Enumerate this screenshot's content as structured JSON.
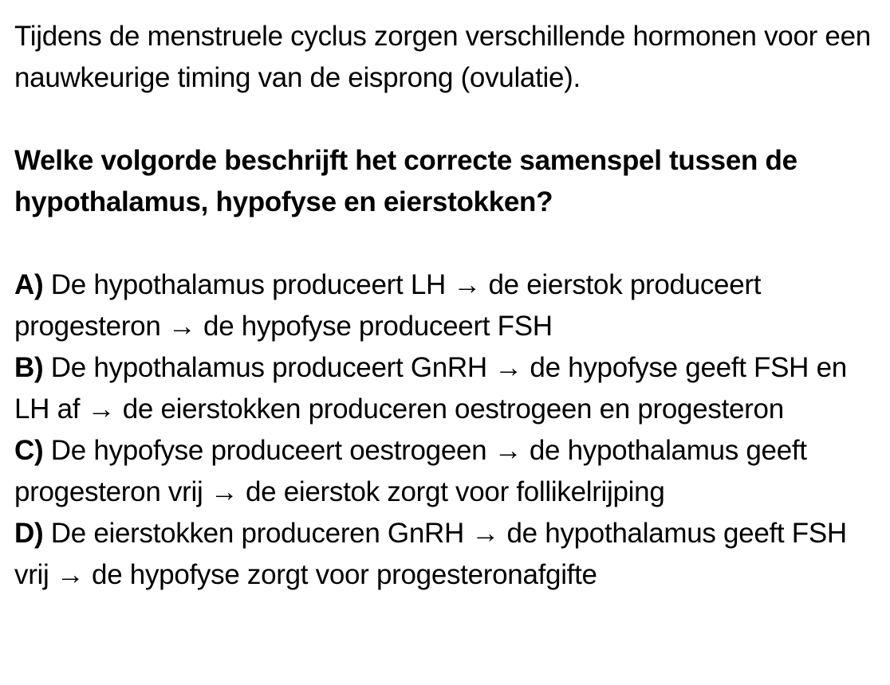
{
  "intro": "Tijdens de menstruele cyclus zorgen verschillende hormonen voor een nauwkeurige timing van de eisprong (ovulatie).",
  "question": "Welke volgorde beschrijft het correcte samenspel tussen de hypothalamus, hypofyse en eierstokken?",
  "options": [
    {
      "letter": "A)",
      "text": " De hypothalamus produceert LH → de eierstok produceert progesteron → de hypofyse produceert FSH"
    },
    {
      "letter": "B)",
      "text": " De hypothalamus produceert GnRH → de hypofyse geeft FSH en LH af → de eierstokken produceren oestrogeen en progesteron"
    },
    {
      "letter": "C)",
      "text": " De hypofyse produceert oestrogeen → de hypothalamus geeft progesteron vrij → de eierstok zorgt voor follikelrijping"
    },
    {
      "letter": "D)",
      "text": " De eierstokken produceren GnRH → de hypothalamus geeft FSH vrij → de hypofyse zorgt voor progesteronafgifte"
    }
  ]
}
